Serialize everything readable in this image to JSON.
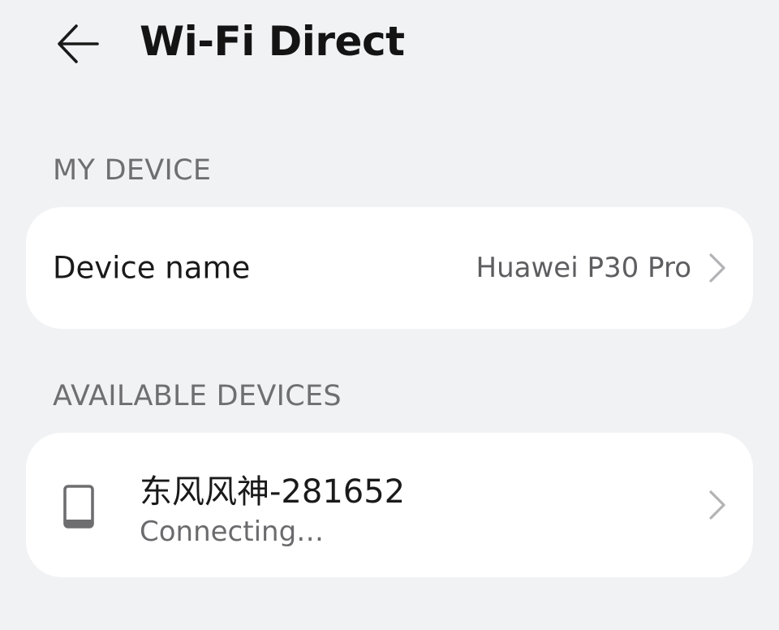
{
  "header": {
    "title": "Wi-Fi Direct",
    "back_icon": "back-arrow-icon"
  },
  "my_device": {
    "section_label": "MY DEVICE",
    "row": {
      "label": "Device name",
      "value": "Huawei P30 Pro",
      "chevron_icon": "chevron-right-icon"
    }
  },
  "available_devices": {
    "section_label": "AVAILABLE DEVICES",
    "items": [
      {
        "icon": "phone-icon",
        "name": "东风风神-281652",
        "status": "Connecting…",
        "chevron_icon": "chevron-right-icon"
      }
    ]
  },
  "colors": {
    "background": "#f1f2f4",
    "card": "#ffffff",
    "primary_text": "#1a1a1a",
    "secondary_text": "#6f6f72",
    "chevron": "#b3b3b6"
  }
}
